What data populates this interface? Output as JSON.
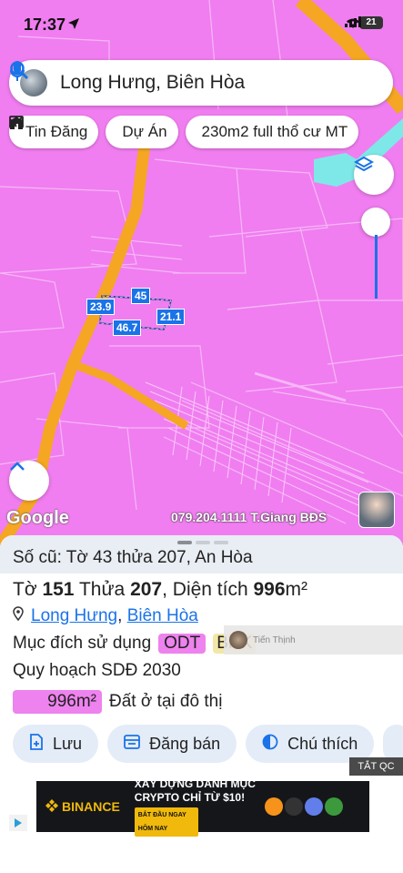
{
  "status_bar": {
    "time": "17:37",
    "battery": "21"
  },
  "search": {
    "query": "Long Hưng, Biên Hòa"
  },
  "chips": [
    {
      "icon": "newspaper-icon",
      "label": "Tin Đăng"
    },
    {
      "icon": "building-icon",
      "label": "Dự Án"
    },
    {
      "icon": "ruler-icon",
      "label": "230m2 full thổ cư MT"
    }
  ],
  "map": {
    "parcel_dims": [
      "45",
      "23.9",
      "21.1",
      "46.7"
    ],
    "google_logo": "Google",
    "watermark": "079.204.1111 T.Giang BĐS",
    "colors": {
      "land": "#f07ef0",
      "road": "#f5a623",
      "water": "#7ee8e8"
    }
  },
  "sheet": {
    "old_plot": "Số cũ: Tờ 43 thửa 207, An Hòa",
    "plot": {
      "sheet_label": "Tờ",
      "sheet_no": "151",
      "parcel_label": "Thửa",
      "parcel_no": "207",
      "area_label": ", Diện tích",
      "area_value": "996",
      "area_unit": "m²"
    },
    "location": {
      "ward": "Long Hưng",
      "separator": ",",
      "city": "Biên Hòa"
    },
    "usage": {
      "label": "Mục đích sử dụng",
      "tag1": "ODT",
      "tag2": "BHK"
    },
    "overlay_text": "Tiến Thịnh",
    "planning": "Quy hoạch SDĐ 2030",
    "area_line": {
      "value": "996m²",
      "desc": "Đất ở tại đô thị"
    }
  },
  "actions": [
    {
      "icon": "add-file-icon",
      "label": "Lưu"
    },
    {
      "icon": "listing-icon",
      "label": "Đăng bán"
    },
    {
      "icon": "legend-icon",
      "label": "Chú thích"
    }
  ],
  "ad": {
    "close_label": "TẮT QC",
    "brand": "BINANCE",
    "line1": "XÂY DỰNG DANH MỤC",
    "line2": "CRYPTO CHỈ TỪ $10!",
    "cta": "BẮT ĐẦU NGAY HÔM NAY"
  }
}
